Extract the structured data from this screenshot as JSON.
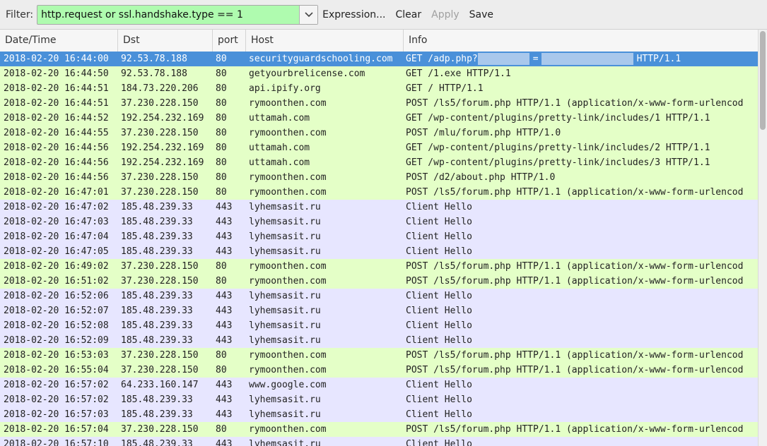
{
  "toolbar": {
    "filter_label": "Filter:",
    "filter_value": "http.request or ssl.handshake.type == 1",
    "filter_valid_color": "#affbaf",
    "expression_label": "Expression...",
    "clear_label": "Clear",
    "apply_label": "Apply",
    "save_label": "Save"
  },
  "columns": [
    "Date/Time",
    "Dst",
    "port",
    "Host",
    "Info"
  ],
  "row_colors": {
    "http": "#e4ffc7",
    "tls": "#e7e6ff",
    "selected": "#4a90d9"
  },
  "packets": [
    {
      "date": "2018-02-20 16:44:00",
      "dst": "92.53.78.188",
      "port": "80",
      "host": "securityguardschooling.com",
      "info_prefix": "GET /adp.php?",
      "info_eq": "=",
      "info_suffix": "HTTP/1.1",
      "type": "selected"
    },
    {
      "date": "2018-02-20 16:44:50",
      "dst": "92.53.78.188",
      "port": "80",
      "host": "getyourbrelicense.com",
      "info": "GET /1.exe HTTP/1.1",
      "type": "http"
    },
    {
      "date": "2018-02-20 16:44:51",
      "dst": "184.73.220.206",
      "port": "80",
      "host": "api.ipify.org",
      "info": "GET / HTTP/1.1",
      "type": "http"
    },
    {
      "date": "2018-02-20 16:44:51",
      "dst": "37.230.228.150",
      "port": "80",
      "host": "rymoonthen.com",
      "info": "POST /ls5/forum.php HTTP/1.1  (application/x-www-form-urlencod",
      "type": "http"
    },
    {
      "date": "2018-02-20 16:44:52",
      "dst": "192.254.232.169",
      "port": "80",
      "host": "uttamah.com",
      "info": "GET /wp-content/plugins/pretty-link/includes/1 HTTP/1.1",
      "type": "http"
    },
    {
      "date": "2018-02-20 16:44:55",
      "dst": "37.230.228.150",
      "port": "80",
      "host": "rymoonthen.com",
      "info": "POST /mlu/forum.php HTTP/1.0",
      "type": "http"
    },
    {
      "date": "2018-02-20 16:44:56",
      "dst": "192.254.232.169",
      "port": "80",
      "host": "uttamah.com",
      "info": "GET /wp-content/plugins/pretty-link/includes/2 HTTP/1.1",
      "type": "http"
    },
    {
      "date": "2018-02-20 16:44:56",
      "dst": "192.254.232.169",
      "port": "80",
      "host": "uttamah.com",
      "info": "GET /wp-content/plugins/pretty-link/includes/3 HTTP/1.1",
      "type": "http"
    },
    {
      "date": "2018-02-20 16:44:56",
      "dst": "37.230.228.150",
      "port": "80",
      "host": "rymoonthen.com",
      "info": "POST /d2/about.php HTTP/1.0",
      "type": "http"
    },
    {
      "date": "2018-02-20 16:47:01",
      "dst": "37.230.228.150",
      "port": "80",
      "host": "rymoonthen.com",
      "info": "POST /ls5/forum.php HTTP/1.1  (application/x-www-form-urlencod",
      "type": "http"
    },
    {
      "date": "2018-02-20 16:47:02",
      "dst": "185.48.239.33",
      "port": "443",
      "host": "lyhemsasit.ru",
      "info": "Client Hello",
      "type": "tls"
    },
    {
      "date": "2018-02-20 16:47:03",
      "dst": "185.48.239.33",
      "port": "443",
      "host": "lyhemsasit.ru",
      "info": "Client Hello",
      "type": "tls"
    },
    {
      "date": "2018-02-20 16:47:04",
      "dst": "185.48.239.33",
      "port": "443",
      "host": "lyhemsasit.ru",
      "info": "Client Hello",
      "type": "tls"
    },
    {
      "date": "2018-02-20 16:47:05",
      "dst": "185.48.239.33",
      "port": "443",
      "host": "lyhemsasit.ru",
      "info": "Client Hello",
      "type": "tls"
    },
    {
      "date": "2018-02-20 16:49:02",
      "dst": "37.230.228.150",
      "port": "80",
      "host": "rymoonthen.com",
      "info": "POST /ls5/forum.php HTTP/1.1  (application/x-www-form-urlencod",
      "type": "http"
    },
    {
      "date": "2018-02-20 16:51:02",
      "dst": "37.230.228.150",
      "port": "80",
      "host": "rymoonthen.com",
      "info": "POST /ls5/forum.php HTTP/1.1  (application/x-www-form-urlencod",
      "type": "http"
    },
    {
      "date": "2018-02-20 16:52:06",
      "dst": "185.48.239.33",
      "port": "443",
      "host": "lyhemsasit.ru",
      "info": "Client Hello",
      "type": "tls"
    },
    {
      "date": "2018-02-20 16:52:07",
      "dst": "185.48.239.33",
      "port": "443",
      "host": "lyhemsasit.ru",
      "info": "Client Hello",
      "type": "tls"
    },
    {
      "date": "2018-02-20 16:52:08",
      "dst": "185.48.239.33",
      "port": "443",
      "host": "lyhemsasit.ru",
      "info": "Client Hello",
      "type": "tls"
    },
    {
      "date": "2018-02-20 16:52:09",
      "dst": "185.48.239.33",
      "port": "443",
      "host": "lyhemsasit.ru",
      "info": "Client Hello",
      "type": "tls"
    },
    {
      "date": "2018-02-20 16:53:03",
      "dst": "37.230.228.150",
      "port": "80",
      "host": "rymoonthen.com",
      "info": "POST /ls5/forum.php HTTP/1.1  (application/x-www-form-urlencod",
      "type": "http"
    },
    {
      "date": "2018-02-20 16:55:04",
      "dst": "37.230.228.150",
      "port": "80",
      "host": "rymoonthen.com",
      "info": "POST /ls5/forum.php HTTP/1.1  (application/x-www-form-urlencod",
      "type": "http"
    },
    {
      "date": "2018-02-20 16:57:02",
      "dst": "64.233.160.147",
      "port": "443",
      "host": "www.google.com",
      "info": "Client Hello",
      "type": "tls"
    },
    {
      "date": "2018-02-20 16:57:02",
      "dst": "185.48.239.33",
      "port": "443",
      "host": "lyhemsasit.ru",
      "info": "Client Hello",
      "type": "tls"
    },
    {
      "date": "2018-02-20 16:57:03",
      "dst": "185.48.239.33",
      "port": "443",
      "host": "lyhemsasit.ru",
      "info": "Client Hello",
      "type": "tls"
    },
    {
      "date": "2018-02-20 16:57:04",
      "dst": "37.230.228.150",
      "port": "80",
      "host": "rymoonthen.com",
      "info": "POST /ls5/forum.php HTTP/1.1  (application/x-www-form-urlencod",
      "type": "http"
    },
    {
      "date": "2018-02-20 16:57:10",
      "dst": "185.48.239.33",
      "port": "443",
      "host": "lyhemsasit.ru",
      "info": "Client Hello",
      "type": "tls"
    }
  ]
}
